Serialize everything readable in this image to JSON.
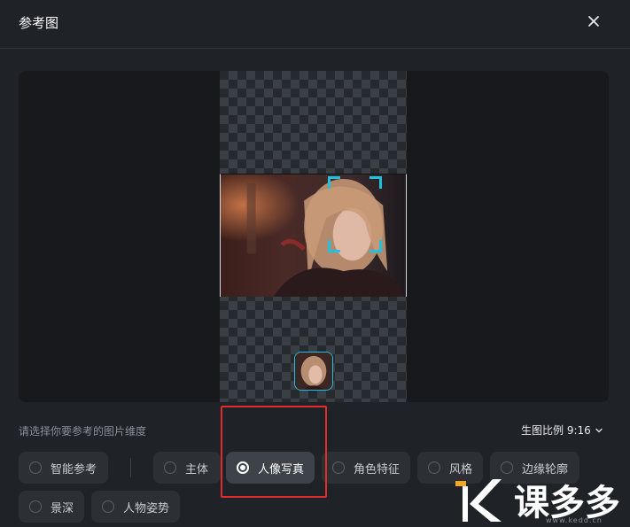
{
  "dialog": {
    "title": "参考图",
    "close_icon": "close-icon"
  },
  "preview": {
    "image_aspect": "9:16",
    "face_detection_frame_color": "#1fc1e0",
    "thumbnail_icon": "portrait-thumbnail"
  },
  "options": {
    "hint": "请选择你要参考的图片维度",
    "ratio_label": "生图比例 9:16",
    "chips": [
      {
        "label": "智能参考",
        "selected": false
      },
      {
        "label": "主体",
        "selected": false
      },
      {
        "label": "人像写真",
        "selected": true
      },
      {
        "label": "角色特征",
        "selected": false
      },
      {
        "label": "风格",
        "selected": false
      },
      {
        "label": "边缘轮廓",
        "selected": false
      },
      {
        "label": "景深",
        "selected": false
      },
      {
        "label": "人物姿势",
        "selected": false
      }
    ]
  },
  "annotation": {
    "highlight_color": "#e32b2b"
  },
  "watermark": {
    "text": "课多多",
    "url": "www.kedd.cn"
  }
}
